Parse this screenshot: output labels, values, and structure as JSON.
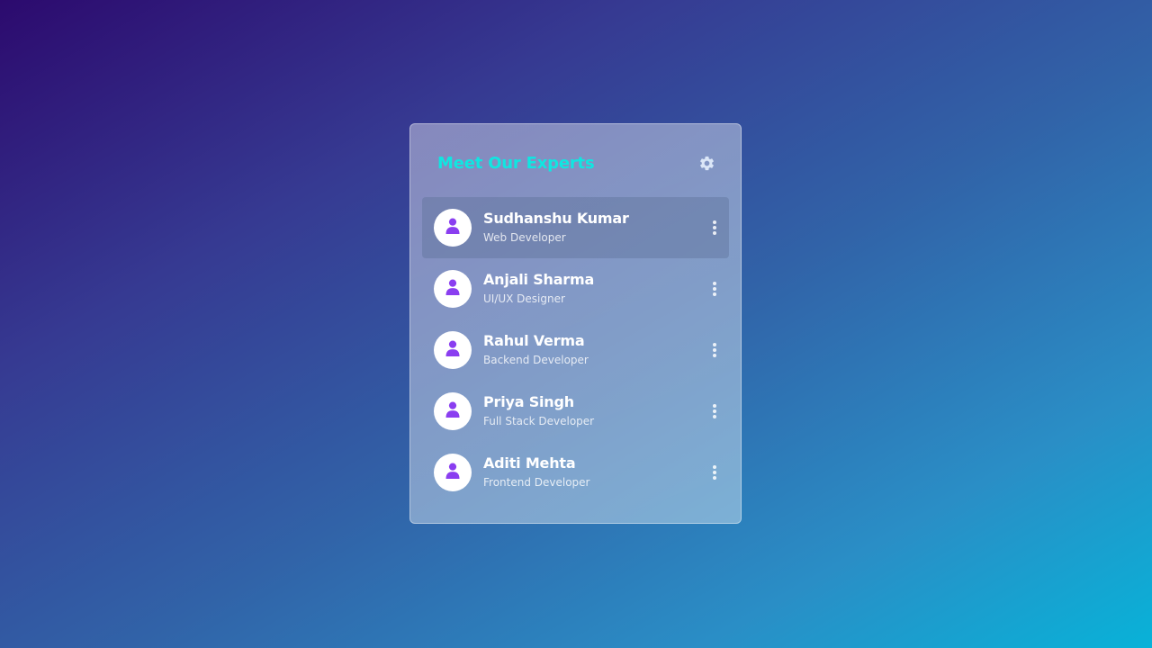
{
  "card": {
    "title": "Meet Our Experts",
    "settings_icon": "gear-icon"
  },
  "colors": {
    "title_accent": "#10e6e1",
    "avatar_icon": "#8a3ef0",
    "active_row": "#5f739b"
  },
  "experts": [
    {
      "name": "Sudhanshu Kumar",
      "role": "Web Developer",
      "active": true,
      "avatar_icon": "user-icon",
      "menu_icon": "more-vertical-icon"
    },
    {
      "name": "Anjali Sharma",
      "role": "UI/UX Designer",
      "active": false,
      "avatar_icon": "user-icon",
      "menu_icon": "more-vertical-icon"
    },
    {
      "name": "Rahul Verma",
      "role": "Backend Developer",
      "active": false,
      "avatar_icon": "user-icon",
      "menu_icon": "more-vertical-icon"
    },
    {
      "name": "Priya Singh",
      "role": "Full Stack Developer",
      "active": false,
      "avatar_icon": "user-icon",
      "menu_icon": "more-vertical-icon"
    },
    {
      "name": "Aditi Mehta",
      "role": "Frontend Developer",
      "active": false,
      "avatar_icon": "user-icon",
      "menu_icon": "more-vertical-icon"
    }
  ]
}
